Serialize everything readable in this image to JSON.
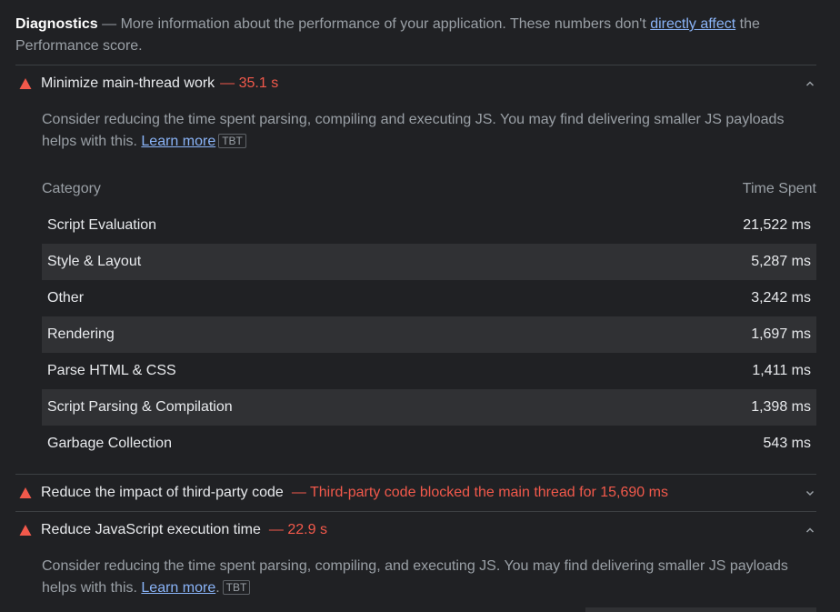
{
  "header": {
    "title": "Diagnostics",
    "text_before_link": " — More information about the performance of your application. These numbers don't ",
    "link": "directly affect",
    "text_after_link": " the Performance score."
  },
  "audits": [
    {
      "title": "Minimize main-thread work",
      "value": "— 35.1 s",
      "expanded": true,
      "description": "Consider reducing the time spent parsing, compiling and executing JS. You may find delivering smaller JS payloads helps with this. ",
      "learn_more": "Learn more",
      "tag": "TBT"
    },
    {
      "title": "Reduce the impact of third-party code",
      "value": "— Third-party code blocked the main thread for 15,690 ms",
      "expanded": false
    },
    {
      "title": "Reduce JavaScript execution time",
      "value": "— 22.9 s",
      "expanded": true,
      "description": "Consider reducing the time spent parsing, compiling, and executing JS. You may find delivering smaller JS payloads helps with this. ",
      "learn_more": "Learn more",
      "after_link": ".",
      "tag": "TBT"
    }
  ],
  "table": {
    "headers": [
      "Category",
      "Time Spent"
    ],
    "rows": [
      {
        "category": "Script Evaluation",
        "time": "21,522 ms"
      },
      {
        "category": "Style & Layout",
        "time": "5,287 ms"
      },
      {
        "category": "Other",
        "time": "3,242 ms"
      },
      {
        "category": "Rendering",
        "time": "1,697 ms"
      },
      {
        "category": "Parse HTML & CSS",
        "time": "1,411 ms"
      },
      {
        "category": "Script Parsing & Compilation",
        "time": "1,398 ms"
      },
      {
        "category": "Garbage Collection",
        "time": "543 ms"
      }
    ]
  },
  "icons": {
    "warning": "warning-triangle-icon",
    "collapse": "chevron-up-icon",
    "expand": "chevron-down-icon"
  },
  "colors": {
    "background": "#202124",
    "fail_red": "#f2594b",
    "link": "#8ab4f8",
    "row_alt": "#303134"
  }
}
